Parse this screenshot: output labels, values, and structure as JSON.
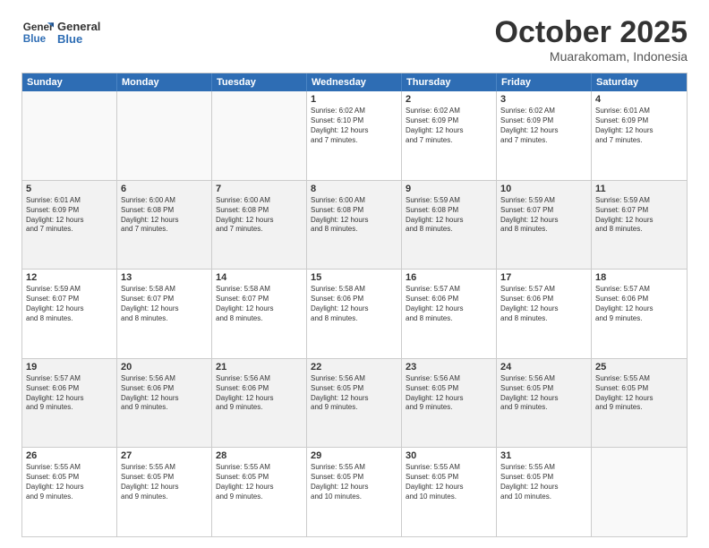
{
  "logo": {
    "line1": "General",
    "line2": "Blue"
  },
  "title": "October 2025",
  "subtitle": "Muarakomam, Indonesia",
  "header_days": [
    "Sunday",
    "Monday",
    "Tuesday",
    "Wednesday",
    "Thursday",
    "Friday",
    "Saturday"
  ],
  "rows": [
    [
      {
        "day": "",
        "text": "",
        "empty": true
      },
      {
        "day": "",
        "text": "",
        "empty": true
      },
      {
        "day": "",
        "text": "",
        "empty": true
      },
      {
        "day": "1",
        "text": "Sunrise: 6:02 AM\nSunset: 6:10 PM\nDaylight: 12 hours\nand 7 minutes.",
        "empty": false,
        "shaded": false
      },
      {
        "day": "2",
        "text": "Sunrise: 6:02 AM\nSunset: 6:09 PM\nDaylight: 12 hours\nand 7 minutes.",
        "empty": false,
        "shaded": false
      },
      {
        "day": "3",
        "text": "Sunrise: 6:02 AM\nSunset: 6:09 PM\nDaylight: 12 hours\nand 7 minutes.",
        "empty": false,
        "shaded": false
      },
      {
        "day": "4",
        "text": "Sunrise: 6:01 AM\nSunset: 6:09 PM\nDaylight: 12 hours\nand 7 minutes.",
        "empty": false,
        "shaded": false
      }
    ],
    [
      {
        "day": "5",
        "text": "Sunrise: 6:01 AM\nSunset: 6:09 PM\nDaylight: 12 hours\nand 7 minutes.",
        "empty": false,
        "shaded": true
      },
      {
        "day": "6",
        "text": "Sunrise: 6:00 AM\nSunset: 6:08 PM\nDaylight: 12 hours\nand 7 minutes.",
        "empty": false,
        "shaded": true
      },
      {
        "day": "7",
        "text": "Sunrise: 6:00 AM\nSunset: 6:08 PM\nDaylight: 12 hours\nand 7 minutes.",
        "empty": false,
        "shaded": true
      },
      {
        "day": "8",
        "text": "Sunrise: 6:00 AM\nSunset: 6:08 PM\nDaylight: 12 hours\nand 8 minutes.",
        "empty": false,
        "shaded": true
      },
      {
        "day": "9",
        "text": "Sunrise: 5:59 AM\nSunset: 6:08 PM\nDaylight: 12 hours\nand 8 minutes.",
        "empty": false,
        "shaded": true
      },
      {
        "day": "10",
        "text": "Sunrise: 5:59 AM\nSunset: 6:07 PM\nDaylight: 12 hours\nand 8 minutes.",
        "empty": false,
        "shaded": true
      },
      {
        "day": "11",
        "text": "Sunrise: 5:59 AM\nSunset: 6:07 PM\nDaylight: 12 hours\nand 8 minutes.",
        "empty": false,
        "shaded": true
      }
    ],
    [
      {
        "day": "12",
        "text": "Sunrise: 5:59 AM\nSunset: 6:07 PM\nDaylight: 12 hours\nand 8 minutes.",
        "empty": false,
        "shaded": false
      },
      {
        "day": "13",
        "text": "Sunrise: 5:58 AM\nSunset: 6:07 PM\nDaylight: 12 hours\nand 8 minutes.",
        "empty": false,
        "shaded": false
      },
      {
        "day": "14",
        "text": "Sunrise: 5:58 AM\nSunset: 6:07 PM\nDaylight: 12 hours\nand 8 minutes.",
        "empty": false,
        "shaded": false
      },
      {
        "day": "15",
        "text": "Sunrise: 5:58 AM\nSunset: 6:06 PM\nDaylight: 12 hours\nand 8 minutes.",
        "empty": false,
        "shaded": false
      },
      {
        "day": "16",
        "text": "Sunrise: 5:57 AM\nSunset: 6:06 PM\nDaylight: 12 hours\nand 8 minutes.",
        "empty": false,
        "shaded": false
      },
      {
        "day": "17",
        "text": "Sunrise: 5:57 AM\nSunset: 6:06 PM\nDaylight: 12 hours\nand 8 minutes.",
        "empty": false,
        "shaded": false
      },
      {
        "day": "18",
        "text": "Sunrise: 5:57 AM\nSunset: 6:06 PM\nDaylight: 12 hours\nand 9 minutes.",
        "empty": false,
        "shaded": false
      }
    ],
    [
      {
        "day": "19",
        "text": "Sunrise: 5:57 AM\nSunset: 6:06 PM\nDaylight: 12 hours\nand 9 minutes.",
        "empty": false,
        "shaded": true
      },
      {
        "day": "20",
        "text": "Sunrise: 5:56 AM\nSunset: 6:06 PM\nDaylight: 12 hours\nand 9 minutes.",
        "empty": false,
        "shaded": true
      },
      {
        "day": "21",
        "text": "Sunrise: 5:56 AM\nSunset: 6:06 PM\nDaylight: 12 hours\nand 9 minutes.",
        "empty": false,
        "shaded": true
      },
      {
        "day": "22",
        "text": "Sunrise: 5:56 AM\nSunset: 6:05 PM\nDaylight: 12 hours\nand 9 minutes.",
        "empty": false,
        "shaded": true
      },
      {
        "day": "23",
        "text": "Sunrise: 5:56 AM\nSunset: 6:05 PM\nDaylight: 12 hours\nand 9 minutes.",
        "empty": false,
        "shaded": true
      },
      {
        "day": "24",
        "text": "Sunrise: 5:56 AM\nSunset: 6:05 PM\nDaylight: 12 hours\nand 9 minutes.",
        "empty": false,
        "shaded": true
      },
      {
        "day": "25",
        "text": "Sunrise: 5:55 AM\nSunset: 6:05 PM\nDaylight: 12 hours\nand 9 minutes.",
        "empty": false,
        "shaded": true
      }
    ],
    [
      {
        "day": "26",
        "text": "Sunrise: 5:55 AM\nSunset: 6:05 PM\nDaylight: 12 hours\nand 9 minutes.",
        "empty": false,
        "shaded": false
      },
      {
        "day": "27",
        "text": "Sunrise: 5:55 AM\nSunset: 6:05 PM\nDaylight: 12 hours\nand 9 minutes.",
        "empty": false,
        "shaded": false
      },
      {
        "day": "28",
        "text": "Sunrise: 5:55 AM\nSunset: 6:05 PM\nDaylight: 12 hours\nand 9 minutes.",
        "empty": false,
        "shaded": false
      },
      {
        "day": "29",
        "text": "Sunrise: 5:55 AM\nSunset: 6:05 PM\nDaylight: 12 hours\nand 10 minutes.",
        "empty": false,
        "shaded": false
      },
      {
        "day": "30",
        "text": "Sunrise: 5:55 AM\nSunset: 6:05 PM\nDaylight: 12 hours\nand 10 minutes.",
        "empty": false,
        "shaded": false
      },
      {
        "day": "31",
        "text": "Sunrise: 5:55 AM\nSunset: 6:05 PM\nDaylight: 12 hours\nand 10 minutes.",
        "empty": false,
        "shaded": false
      },
      {
        "day": "",
        "text": "",
        "empty": true
      }
    ]
  ]
}
